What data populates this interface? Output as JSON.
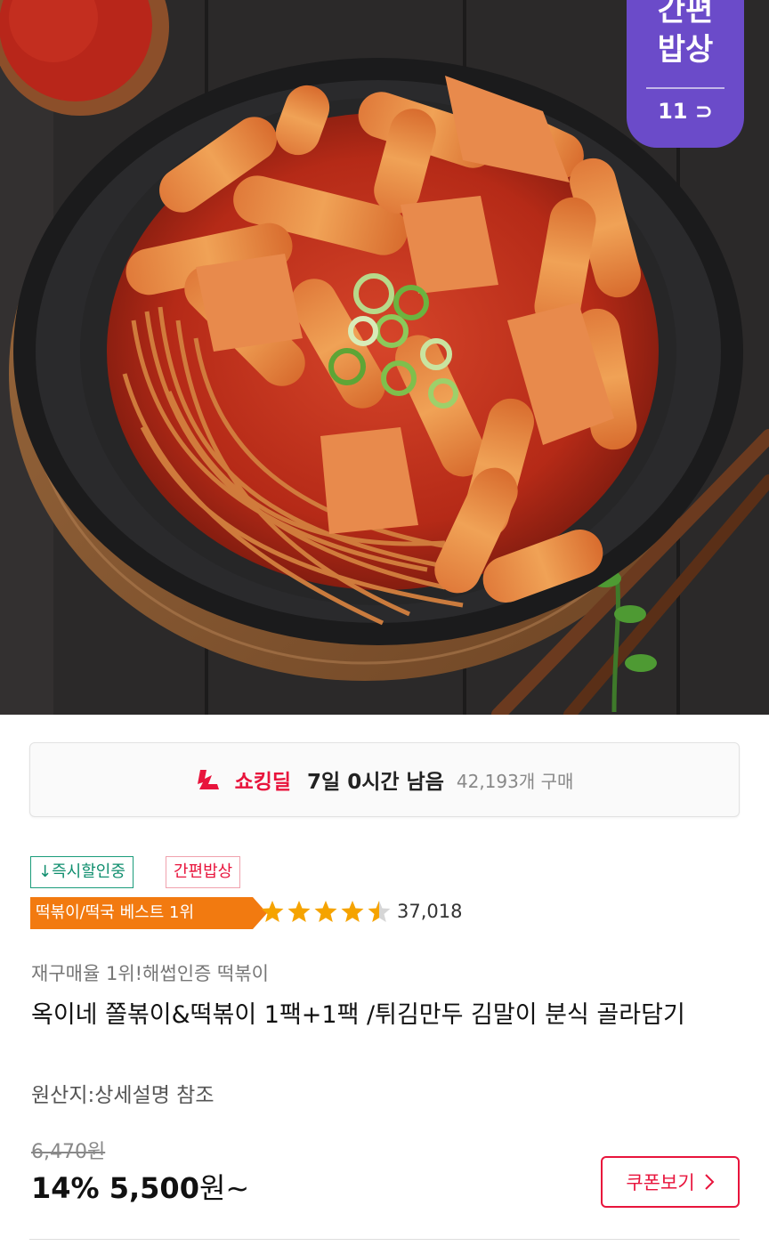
{
  "hero": {
    "badge_line1": "간편",
    "badge_line2": "밥상",
    "badge_line3": "11"
  },
  "deal": {
    "name": "쇼킹딜",
    "time_left": "7일 0시간 남음",
    "purchase_count": "42,193개 구매"
  },
  "tags": {
    "instant": "↓즉시할인중",
    "simple": "간편밥상"
  },
  "best_ribbon": "떡볶이/떡국 베스트 1위",
  "rating": {
    "value": 4.5,
    "max": 5,
    "count": "37,018"
  },
  "product": {
    "subtitle": "재구매율 1위!해썹인증 떡볶이",
    "title": "옥이네 쫄볶이&떡볶이 1팩+1팩 /튀김만두 김말이 분식 골라담기",
    "origin": "원산지:상세설명 참조"
  },
  "price": {
    "original": "6,470원",
    "discount": "14%",
    "amount": "5,500",
    "unit": "원~"
  },
  "coupon_label": "쿠폰보기",
  "colors": {
    "accent_red": "#e8143c",
    "badge_purple": "#6b4bc9",
    "best_orange": "#f27a10",
    "instant_green": "#0f8e6e",
    "star": "#f5a300"
  }
}
